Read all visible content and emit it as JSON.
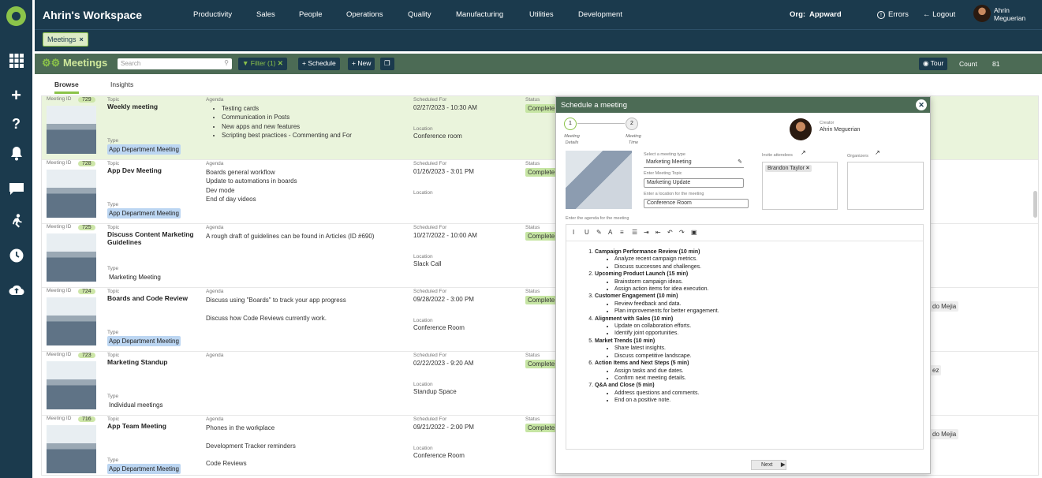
{
  "app": {
    "workspace": "Ahrin's Workspace"
  },
  "nav": [
    "Productivity",
    "Sales",
    "People",
    "Operations",
    "Quality",
    "Manufacturing",
    "Utilities",
    "Development"
  ],
  "org": {
    "label": "Org:",
    "value": "Appward"
  },
  "topright": {
    "errors": "Errors",
    "logout": "Logout",
    "user_line1": "Ahrin",
    "user_line2": "Meguerian"
  },
  "sidebar": {
    "icons": [
      "apps-icon",
      "add-icon",
      "help-icon",
      "bell-icon",
      "chat-icon",
      "run-icon",
      "clock-icon",
      "cloud-upload-icon"
    ]
  },
  "tag": {
    "label": "Meetings",
    "close": "×"
  },
  "header": {
    "title": "Meetings",
    "search_placeholder": "Search",
    "filter": "Filter (1)",
    "schedule": "+ Schedule",
    "new": "+ New",
    "tour": "Tour",
    "count_label": "Count",
    "count_value": "81"
  },
  "tabs": {
    "browse": "Browse",
    "insights": "Insights"
  },
  "labels": {
    "meeting_id": "Meeting ID",
    "topic": "Topic",
    "type": "Type",
    "agenda": "Agenda",
    "scheduled_for": "Scheduled For",
    "location": "Location",
    "status": "Status"
  },
  "rows": [
    {
      "id": "729",
      "topic": "Weekly meeting",
      "type": "App Department Meeting",
      "agenda_list": [
        "Testing cards",
        "Communication in Posts",
        "New apps and new features",
        "Scripting best practices - Commenting and For"
      ],
      "agenda_text": [],
      "scheduled": "02/27/2023 - 10:30 AM",
      "location": "Conference room",
      "status": "Complete",
      "extra": ""
    },
    {
      "id": "728",
      "topic": "App Dev Meeting",
      "type": "App Department Meeting",
      "agenda_list": [],
      "agenda_text": [
        "Boards general workflow",
        "Update to automations in boards",
        "Dev mode",
        "End of day videos"
      ],
      "scheduled": "01/26/2023 - 3:01 PM",
      "location": "",
      "status": "Complete",
      "extra": ""
    },
    {
      "id": "725",
      "topic": "Discuss Content Marketing Guidelines",
      "type": "Marketing Meeting",
      "agenda_list": [],
      "agenda_text": [
        "A rough draft of guidelines can be found in Articles (ID #690)"
      ],
      "scheduled": "10/27/2022 - 10:00 AM",
      "location": "Slack Call",
      "status": "Complete",
      "extra": ""
    },
    {
      "id": "724",
      "topic": "Boards and Code Review",
      "type": "App Department Meeting",
      "agenda_list": [],
      "agenda_text": [
        "Discuss using \"Boards\" to track your app progress",
        "",
        "Discuss how Code Reviews currently work."
      ],
      "scheduled": "09/28/2022 - 3:00 PM",
      "location": "Conference Room",
      "status": "Complete",
      "extra": "do Mejia"
    },
    {
      "id": "723",
      "topic": "Marketing Standup",
      "type": "Individual meetings",
      "agenda_list": [],
      "agenda_text": [],
      "scheduled": "02/22/2023 - 9:20 AM",
      "location": "Standup Space",
      "status": "Complete",
      "extra": "ez"
    },
    {
      "id": "716",
      "topic": "App Team Meeting",
      "type": "App Department Meeting",
      "agenda_list": [],
      "agenda_text": [
        "Phones in the workplace",
        "",
        "Development Tracker reminders",
        "",
        "Code Reviews"
      ],
      "scheduled": "09/21/2022 - 2:00 PM",
      "location": "Conference Room",
      "status": "Complete",
      "extra": "do Mejia"
    }
  ],
  "modal": {
    "title": "Schedule a meeting",
    "step1_num": "1",
    "step1_label_a": "Meeting",
    "step1_label_b": "Details",
    "step2_num": "2",
    "step2_label_a": "Meeting",
    "step2_label_b": "Time",
    "creator_label": "Creator",
    "creator_name": "Ahrin Meguerian",
    "type_label": "Select a meeting type",
    "type_value": "Marketing Meeting",
    "topic_label": "Enter Meeting Topic",
    "topic_value": "Marketing Update",
    "location_label": "Enter a location for the meeting",
    "location_value": "Conference Room",
    "attendees_label": "Invite attendees",
    "attendee": "Brandon Taylor",
    "organizers_label": "Organizers",
    "agenda_label": "Enter the agenda for the meeting",
    "toolbar": [
      "I",
      "U",
      "✎",
      "A",
      "≡",
      "☰",
      "⇥",
      "⇤",
      "↶",
      "↷",
      "▣"
    ],
    "agenda": [
      {
        "title": "Campaign Performance Review (10 min)",
        "items": [
          "Analyze recent campaign metrics.",
          "Discuss successes and challenges."
        ]
      },
      {
        "title": "Upcoming Product Launch (15 min)",
        "items": [
          "Brainstorm campaign ideas.",
          "Assign action items for idea execution."
        ]
      },
      {
        "title": "Customer Engagement (10 min)",
        "items": [
          "Review feedback and data.",
          "Plan improvements for better engagement."
        ]
      },
      {
        "title": "Alignment with Sales (10 min)",
        "items": [
          "Update on collaboration efforts.",
          "Identify joint opportunities."
        ]
      },
      {
        "title": "Market Trends (10 min)",
        "items": [
          "Share latest insights.",
          "Discuss competitive landscape."
        ]
      },
      {
        "title": "Action Items and Next Steps (5 min)",
        "items": [
          "Assign tasks and due dates.",
          "Confirm next meeting details."
        ]
      },
      {
        "title": "Q&A and Close (5 min)",
        "items": [
          "Address questions and comments.",
          "End on a positive note."
        ]
      }
    ],
    "next": "Next"
  },
  "colors": {
    "navy": "#1b3a4d",
    "green_header": "#4c6b55",
    "accent": "#8bc34a",
    "status_bg": "#c6e5a3"
  }
}
